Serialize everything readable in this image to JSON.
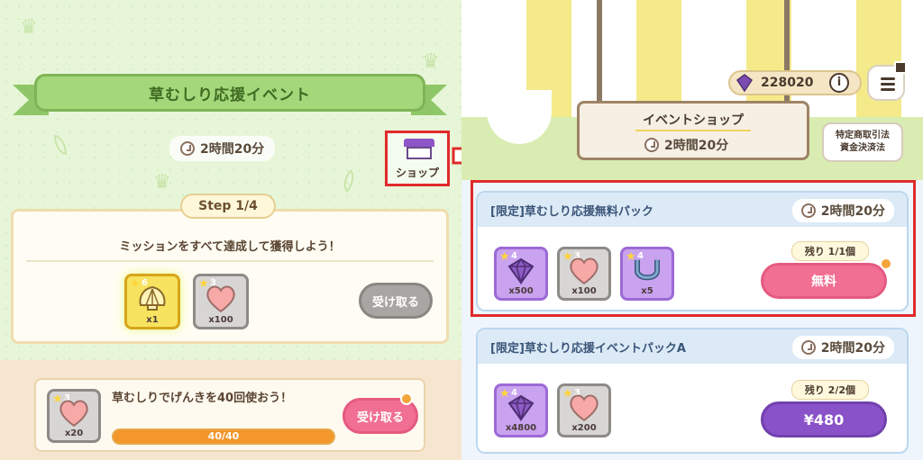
{
  "left": {
    "event_title": "草むしり応援イベント",
    "timer": "2時間20分",
    "shop_label": "ショップ",
    "step_label": "Step 1/4",
    "mission_text": "ミッションをすべて達成して獲得しよう！",
    "rewards": [
      {
        "icon": "shell-icon",
        "stars": "6",
        "qty": "x1"
      },
      {
        "icon": "heart-icon",
        "stars": "3",
        "qty": "x100"
      }
    ],
    "receive_button": "受け取る",
    "quest": {
      "icon": "heart-icon",
      "stars": "3",
      "qty": "x20",
      "text": "草むしりでげんきを40回使おう！",
      "progress_text": "40/40",
      "progress_fraction": 1.0,
      "button": "受け取る"
    }
  },
  "right": {
    "gem_count": "228020",
    "shop_title": "イベントショップ",
    "timer": "2時間20分",
    "legal_button": "特定商取引法\n資金決済法",
    "packs": [
      {
        "title": "[限定]草むしり応援無料パック",
        "timer": "2時間20分",
        "remaining": "残り 1/1個",
        "price": "無料",
        "items": [
          {
            "icon": "gem-icon",
            "stars": "4",
            "qty": "x500"
          },
          {
            "icon": "heart-icon",
            "stars": "3",
            "qty": "x100"
          },
          {
            "icon": "horseshoe-icon",
            "stars": "4",
            "qty": "x5"
          }
        ]
      },
      {
        "title": "[限定]草むしり応援イベントパックA",
        "timer": "2時間20分",
        "remaining": "残り 2/2個",
        "price": "¥480",
        "items": [
          {
            "icon": "gem-icon",
            "stars": "4",
            "qty": "x4800"
          },
          {
            "icon": "heart-icon",
            "stars": "3",
            "qty": "x200"
          }
        ]
      }
    ]
  },
  "colors": {
    "accent_green": "#a3d77a",
    "pink_button": "#f06f92",
    "purple_button": "#8a52c9",
    "highlight_red": "#e02a2a"
  }
}
